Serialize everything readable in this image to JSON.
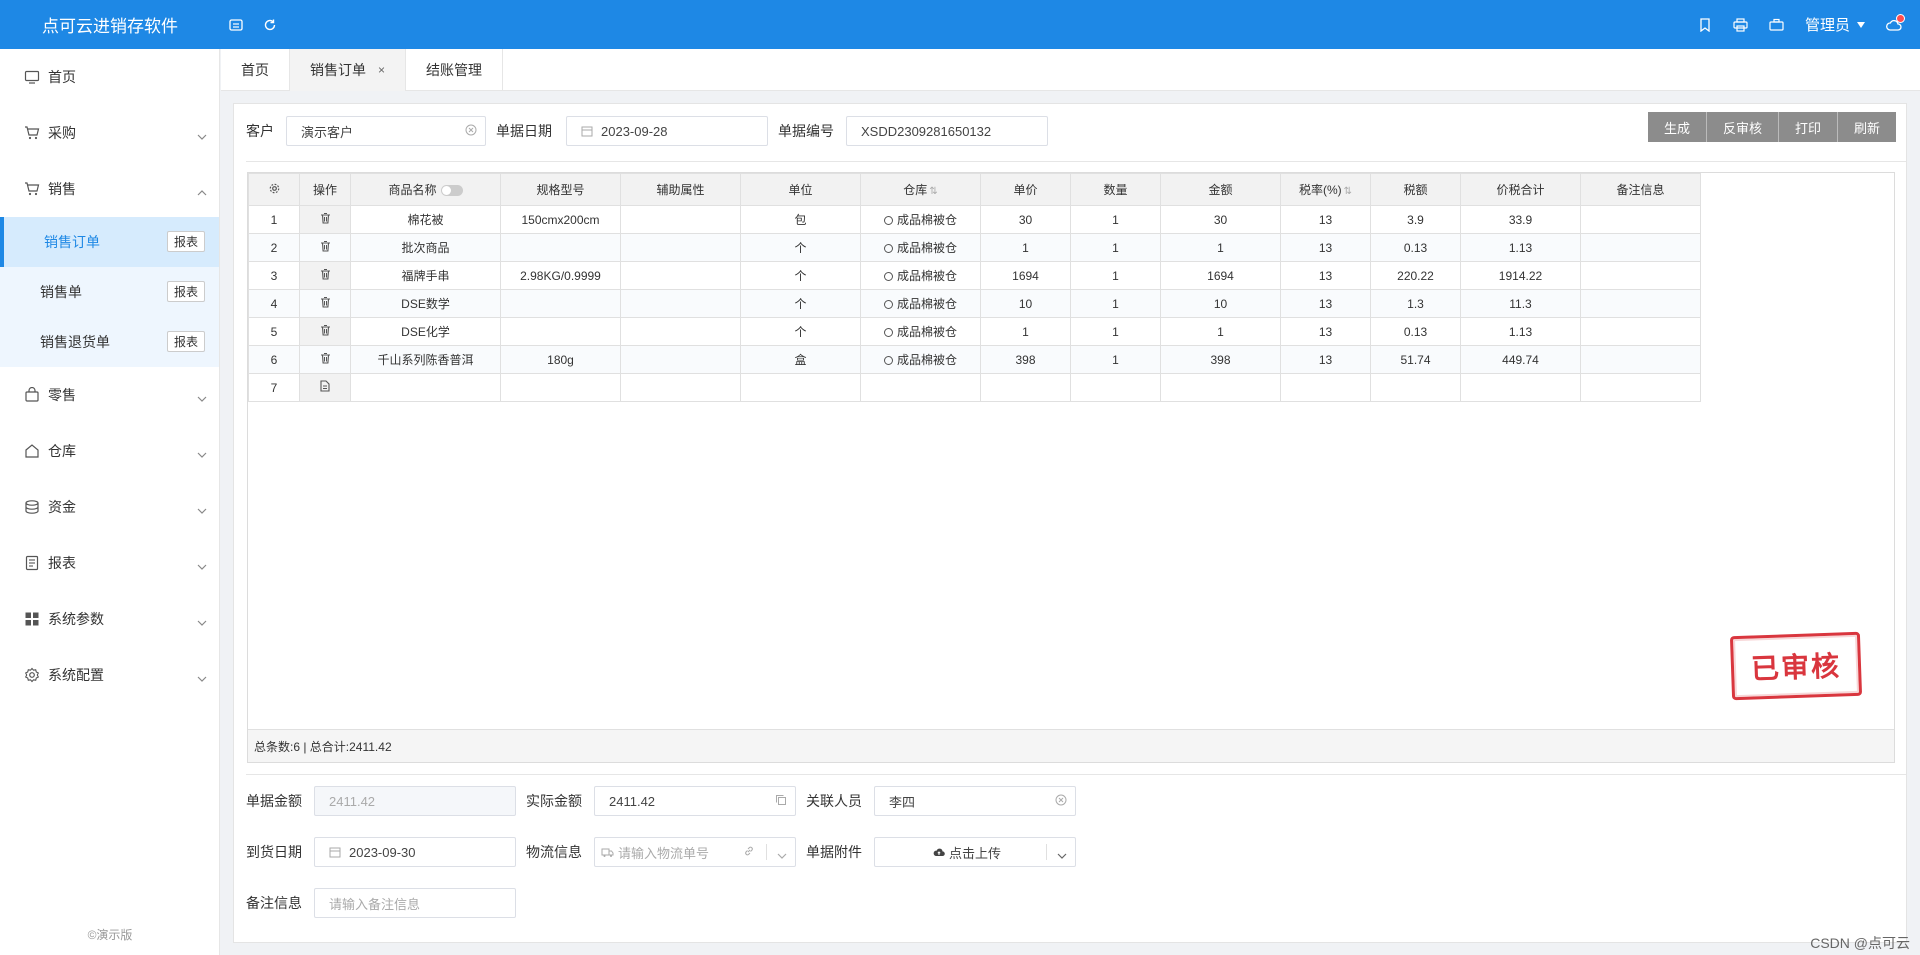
{
  "app": {
    "title": "点可云进销存软件",
    "user": "管理员"
  },
  "sidebar": {
    "items": [
      {
        "label": "首页",
        "icon": "monitor-icon"
      },
      {
        "label": "采购",
        "icon": "cart-icon"
      },
      {
        "label": "销售",
        "icon": "cart-icon"
      },
      {
        "label": "零售",
        "icon": "bag-icon"
      },
      {
        "label": "仓库",
        "icon": "home-icon"
      },
      {
        "label": "资金",
        "icon": "database-icon"
      },
      {
        "label": "报表",
        "icon": "report-icon"
      },
      {
        "label": "系统参数",
        "icon": "grid-icon"
      },
      {
        "label": "系统配置",
        "icon": "gear-icon"
      }
    ],
    "sales_sub": [
      {
        "label": "销售订单",
        "report": "报表"
      },
      {
        "label": "销售单",
        "report": "报表"
      },
      {
        "label": "销售退货单",
        "report": "报表"
      }
    ],
    "copyright": "©演示版"
  },
  "tabs": [
    {
      "label": "首页"
    },
    {
      "label": "销售订单",
      "close": "×"
    },
    {
      "label": "结账管理"
    }
  ],
  "form": {
    "customer_label": "客户",
    "customer_value": "演示客户",
    "date_label": "单据日期",
    "date_value": "2023-09-28",
    "number_label": "单据编号",
    "number_value": "XSDD2309281650132"
  },
  "actions": {
    "generate": "生成",
    "unaudit": "反审核",
    "print": "打印",
    "refresh": "刷新"
  },
  "table": {
    "headers": {
      "op": "操作",
      "name": "商品名称",
      "spec": "规格型号",
      "attr": "辅助属性",
      "unit": "单位",
      "warehouse": "仓库",
      "price": "单价",
      "qty": "数量",
      "amount": "金额",
      "tax_rate": "税率(%)",
      "tax": "税额",
      "total": "价税合计",
      "note": "备注信息"
    },
    "rows": [
      {
        "no": "1",
        "name": "棉花被",
        "spec": "150cmx200cm",
        "attr": "",
        "unit": "包",
        "warehouse": "成品棉被仓",
        "price": "30",
        "qty": "1",
        "amount": "30",
        "tax_rate": "13",
        "tax": "3.9",
        "total": "33.9",
        "note": ""
      },
      {
        "no": "2",
        "name": "批次商品",
        "spec": "",
        "attr": "",
        "unit": "个",
        "warehouse": "成品棉被仓",
        "price": "1",
        "qty": "1",
        "amount": "1",
        "tax_rate": "13",
        "tax": "0.13",
        "total": "1.13",
        "note": ""
      },
      {
        "no": "3",
        "name": "福牌手串",
        "spec": "2.98KG/0.9999",
        "attr": "",
        "unit": "个",
        "warehouse": "成品棉被仓",
        "price": "1694",
        "qty": "1",
        "amount": "1694",
        "tax_rate": "13",
        "tax": "220.22",
        "total": "1914.22",
        "note": ""
      },
      {
        "no": "4",
        "name": "DSE数学",
        "spec": "",
        "attr": "",
        "unit": "个",
        "warehouse": "成品棉被仓",
        "price": "10",
        "qty": "1",
        "amount": "10",
        "tax_rate": "13",
        "tax": "1.3",
        "total": "11.3",
        "note": ""
      },
      {
        "no": "5",
        "name": "DSE化学",
        "spec": "",
        "attr": "",
        "unit": "个",
        "warehouse": "成品棉被仓",
        "price": "1",
        "qty": "1",
        "amount": "1",
        "tax_rate": "13",
        "tax": "0.13",
        "total": "1.13",
        "note": ""
      },
      {
        "no": "6",
        "name": "千山系列陈香普洱",
        "spec": "180g",
        "attr": "",
        "unit": "盒",
        "warehouse": "成品棉被仓",
        "price": "398",
        "qty": "1",
        "amount": "398",
        "tax_rate": "13",
        "tax": "51.74",
        "total": "449.74",
        "note": ""
      }
    ],
    "empty_row_no": "7",
    "summary": "总条数:6 | 总合计:2411.42"
  },
  "stamp": "已审核",
  "footer_form": {
    "doc_amount_label": "单据金额",
    "doc_amount_value": "2411.42",
    "actual_amount_label": "实际金额",
    "actual_amount_value": "2411.42",
    "related_label": "关联人员",
    "related_value": "李四",
    "arrival_label": "到货日期",
    "arrival_value": "2023-09-30",
    "logistics_label": "物流信息",
    "logistics_placeholder": "请输入物流单号",
    "attachment_label": "单据附件",
    "attachment_button": "点击上传",
    "note_label": "备注信息",
    "note_placeholder": "请输入备注信息"
  },
  "watermark": "CSDN @点可云"
}
